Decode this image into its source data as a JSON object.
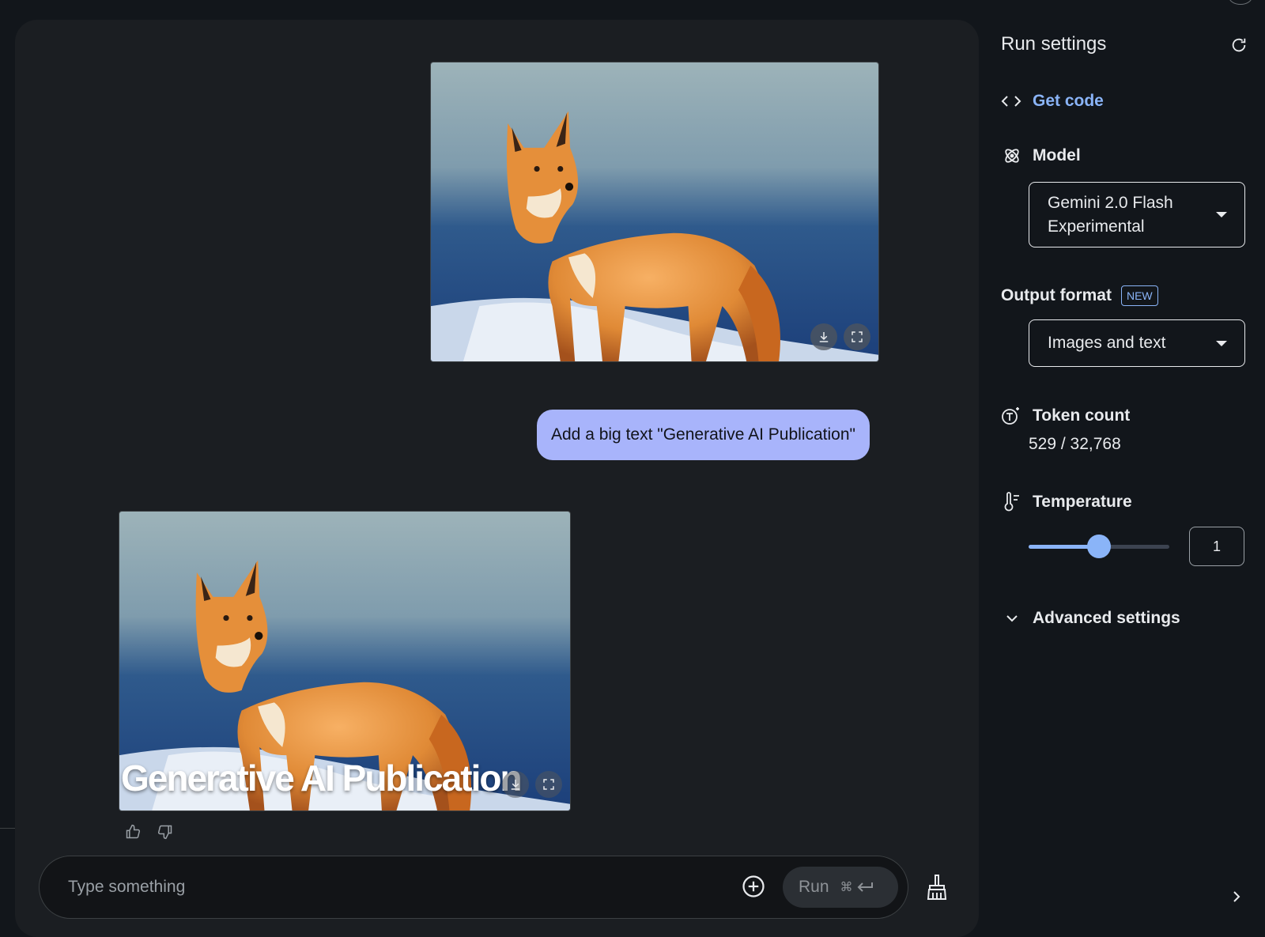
{
  "settings": {
    "title": "Run settings",
    "get_code_label": "Get code",
    "model_label": "Model",
    "model_value_line1": "Gemini 2.0 Flash",
    "model_value_line2": "Experimental",
    "output_format_label": "Output format",
    "output_format_badge": "NEW",
    "output_format_value": "Images and text",
    "token_count_label": "Token count",
    "token_count_value": "529 / 32,768",
    "temperature_label": "Temperature",
    "temperature_value": "1",
    "temperature_fraction": 0.5,
    "advanced_settings_label": "Advanced settings"
  },
  "chat": {
    "user_message": "Add a big text \"Generative AI Publication\"",
    "generated_image_overlay_text": "Generative AI Publication"
  },
  "input": {
    "placeholder": "Type something",
    "run_label": "Run",
    "run_shortcut_symbol": "⌘"
  },
  "icons": {
    "image_download": "download-icon",
    "image_fullscreen": "fullscreen-icon",
    "thumbs_up": "thumbs-up-icon",
    "thumbs_down": "thumbs-down-icon",
    "add": "add-circle-icon",
    "clear": "broom-icon",
    "refresh": "refresh-icon",
    "code": "code-icon",
    "model": "model-icon",
    "token": "token-icon",
    "temperature": "thermometer-icon",
    "expand": "chevron-down-icon",
    "collapse_panel": "chevron-right-icon"
  },
  "colors": {
    "accent": "#8ab4f8",
    "bubble": "#a8b4fb",
    "panel_bg": "#1b1e22",
    "page_bg": "#12161b"
  }
}
